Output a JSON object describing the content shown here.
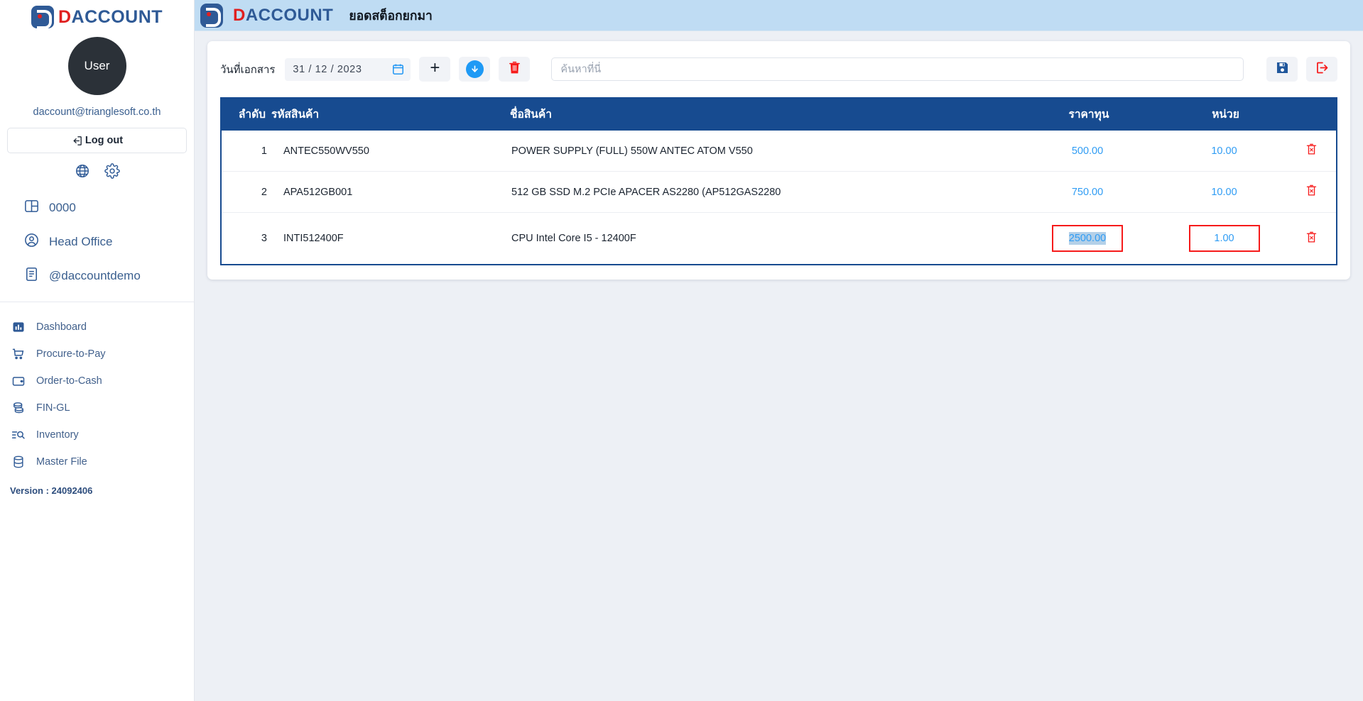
{
  "brand": {
    "name_d": "D",
    "name_rest": "ACCOUNT",
    "mark_icon": "daccount-logo-icon"
  },
  "sidebar": {
    "avatar_label": "User",
    "user_email": "daccount@trianglesoft.co.th",
    "logout_label": "Log out",
    "quick_icons": [
      {
        "name": "globe-icon",
        "label": "globe"
      },
      {
        "name": "gear-icon",
        "label": "settings"
      }
    ],
    "org_items": [
      {
        "icon": "layout-panel-icon",
        "label": "0000"
      },
      {
        "icon": "user-circle-icon",
        "label": "Head Office"
      },
      {
        "icon": "document-icon",
        "label": "@daccountdemo"
      }
    ],
    "nav_items": [
      {
        "icon": "bar-chart-icon",
        "label": "Dashboard"
      },
      {
        "icon": "shopping-cart-icon",
        "label": "Procure-to-Pay"
      },
      {
        "icon": "wallet-icon",
        "label": "Order-to-Cash"
      },
      {
        "icon": "coins-stack-icon",
        "label": "FIN-GL"
      },
      {
        "icon": "list-search-icon",
        "label": "Inventory"
      },
      {
        "icon": "database-icon",
        "label": "Master File"
      }
    ],
    "version_label": "Version : 24092406"
  },
  "header": {
    "page_title": "ยอดสต็อกยกมา"
  },
  "toolbar": {
    "date_label": "วันที่เอกสาร",
    "date_value": "31 / 12 / 2023",
    "calendar_icon": "calendar-icon",
    "add_label": "+",
    "download_icon": "download-circle-icon",
    "delete_icon": "trash-icon",
    "save_icon": "save-disk-icon",
    "exit_icon": "exit-logout-icon",
    "search_placeholder": "ค้นหาที่นี่",
    "search_value": ""
  },
  "table": {
    "columns": {
      "seq": "ลำดับ",
      "code": "รหัสสินค้า",
      "name": "ชื่อสินค้า",
      "cost": "ราคาทุน",
      "unit": "หน่วย",
      "action": ""
    },
    "rows": [
      {
        "seq": "1",
        "code": "ANTEC550WV550",
        "name": "POWER SUPPLY (FULL) 550W ANTEC ATOM V550",
        "cost": "500.00",
        "unit": "10.00",
        "cost_focused": false,
        "unit_focused": false,
        "cost_selected": false,
        "delete_icon": "row-delete-icon"
      },
      {
        "seq": "2",
        "code": "APA512GB001",
        "name": "512 GB SSD M.2 PCIe APACER AS2280 (AP512GAS2280",
        "cost": "750.00",
        "unit": "10.00",
        "cost_focused": false,
        "unit_focused": false,
        "cost_selected": false,
        "delete_icon": "row-delete-icon"
      },
      {
        "seq": "3",
        "code": "INTI512400F",
        "name": "CPU Intel Core I5 - 12400F",
        "cost": "2500.00",
        "unit": "1.00",
        "cost_focused": true,
        "unit_focused": true,
        "cost_selected": true,
        "delete_icon": "row-delete-icon"
      }
    ]
  },
  "colors": {
    "brand_blue": "#2f5a96",
    "brand_red": "#e02020",
    "header_bar": "#bfdcf3",
    "table_header": "#174b90",
    "number_blue": "#2f9cf4",
    "focus_red": "#f61b1b",
    "page_bg": "#edf0f5"
  }
}
